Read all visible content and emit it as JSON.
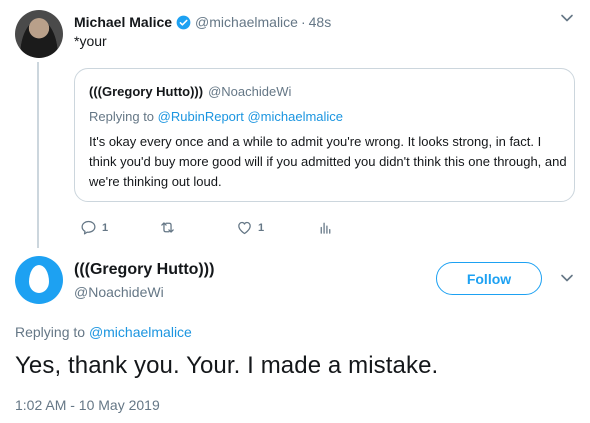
{
  "top_tweet": {
    "display_name": "Michael Malice",
    "handle": "@michaelmalice",
    "separator": "·",
    "time": "48s",
    "text": "*your",
    "verified": true,
    "quoted": {
      "display_name": "(((Gregory Hutto)))",
      "handle": "@NoachideWi",
      "replying_prefix": "Replying to",
      "replying_to": "@RubinReport @michaelmalice",
      "text": "It's okay every once and a while to admit you're wrong. It looks strong, in fact. I think you'd buy more good will if you admitted you didn't think this one through, and we're thinking out loud."
    },
    "actions": {
      "reply_count": "1",
      "retweet_count": "",
      "like_count": "1"
    }
  },
  "main_tweet": {
    "display_name": "(((Gregory Hutto)))",
    "handle": "@NoachideWi",
    "follow_label": "Follow",
    "replying_prefix": "Replying to",
    "replying_to": "@michaelmalice",
    "text": "Yes, thank you. Your. I made a mistake.",
    "timestamp": "1:02 AM - 10 May 2019"
  },
  "colors": {
    "accent": "#1da1f2",
    "link": "#1b95e0",
    "muted": "#657786",
    "border": "#ccd6dd",
    "text": "#14171a"
  },
  "icons": [
    "verified-icon",
    "chevron-down-icon",
    "reply-icon",
    "retweet-icon",
    "like-icon",
    "analytics-icon"
  ]
}
